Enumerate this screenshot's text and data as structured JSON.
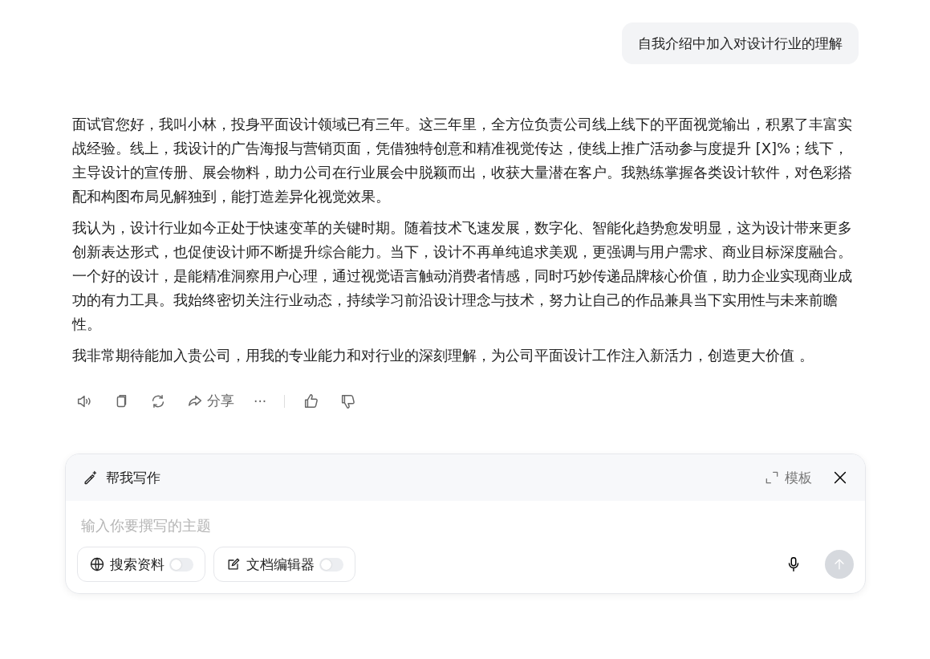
{
  "user_message": {
    "text": "自我介绍中加入对设计行业的理解"
  },
  "answer": {
    "paragraphs": [
      "面试官您好，我叫小林，投身平面设计领域已有三年。这三年里，全方位负责公司线上线下的平面视觉输出，积累了丰富实战经验。线上，我设计的广告海报与营销页面，凭借独特创意和精准视觉传达，使线上推广活动参与度提升 [X]%；线下，主导设计的宣传册、展会物料，助力公司在行业展会中脱颖而出，收获大量潜在客户。我熟练掌握各类设计软件，对色彩搭配和构图布局见解独到，能打造差异化视觉效果。",
      "我认为，设计行业如今正处于快速变革的关键时期。随着技术飞速发展，数字化、智能化趋势愈发明显，这为设计带来更多创新表达形式，也促使设计师不断提升综合能力。当下，设计不再单纯追求美观，更强调与用户需求、商业目标深度融合。一个好的设计，是能精准洞察用户心理，通过视觉语言触动消费者情感，同时巧妙传递品牌核心价值，助力企业实现商业成功的有力工具。我始终密切关注行业动态，持续学习前沿设计理念与技术，努力让自己的作品兼具当下实用性与未来前瞻性。",
      "我非常期待能加入贵公司，用我的专业能力和对行业的深刻理解，为公司平面设计工作注入新活力，创造更大价值 。"
    ],
    "actions": [
      {
        "kind": "speaker"
      },
      {
        "kind": "copy"
      },
      {
        "kind": "regenerate"
      },
      {
        "kind": "share",
        "label": "分享"
      },
      {
        "kind": "more",
        "label": "···"
      },
      {
        "kind": "divider"
      },
      {
        "kind": "like"
      },
      {
        "kind": "dislike"
      }
    ]
  },
  "composer": {
    "mode_title": "帮我写作",
    "template_label": "模板",
    "placeholder": "输入你要撰写的主题",
    "tools": [
      {
        "kind": "web",
        "label": "搜索资料",
        "on": false
      },
      {
        "kind": "doc",
        "label": "文档编辑器",
        "on": false
      }
    ]
  }
}
